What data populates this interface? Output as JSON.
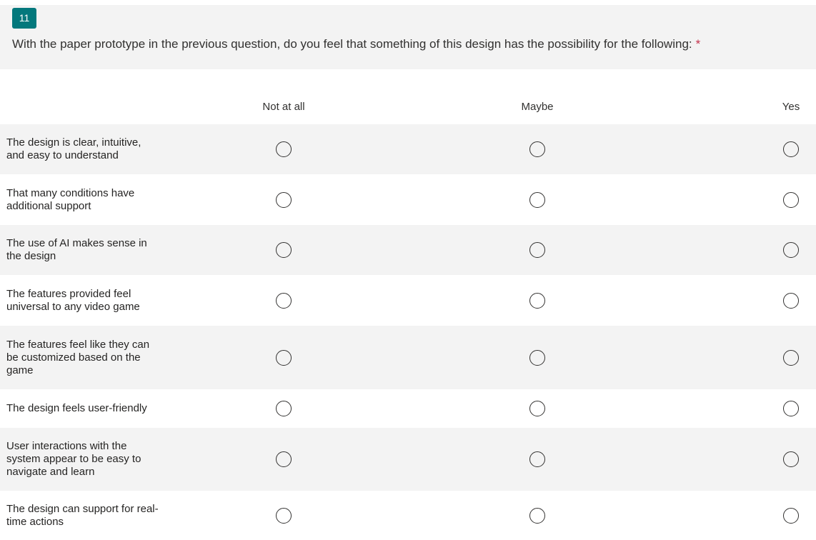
{
  "question": {
    "number": "11",
    "text": "With the paper prototype in the previous question, do you feel that something of this design has the possibility for the following:",
    "required_marker": "*"
  },
  "columns": [
    "Not at all",
    "Maybe",
    "Yes"
  ],
  "rows": [
    {
      "label": "The design is clear, intuitive, and easy to understand",
      "selected": null
    },
    {
      "label": "That many conditions have additional support",
      "selected": null
    },
    {
      "label": "The use of AI makes sense in the design",
      "selected": null
    },
    {
      "label": "The features provided feel universal to any video game",
      "selected": null
    },
    {
      "label": "The features feel like they can be customized based on the game",
      "selected": null
    },
    {
      "label": "The design feels user-friendly",
      "selected": null
    },
    {
      "label": "User interactions with the system appear to be easy to navigate and learn",
      "selected": null
    },
    {
      "label": "The design can support for real-time actions",
      "selected": null
    }
  ],
  "colors": {
    "accent": "#03787c",
    "required": "#c4314b",
    "shaded_row": "#f3f3f3"
  }
}
